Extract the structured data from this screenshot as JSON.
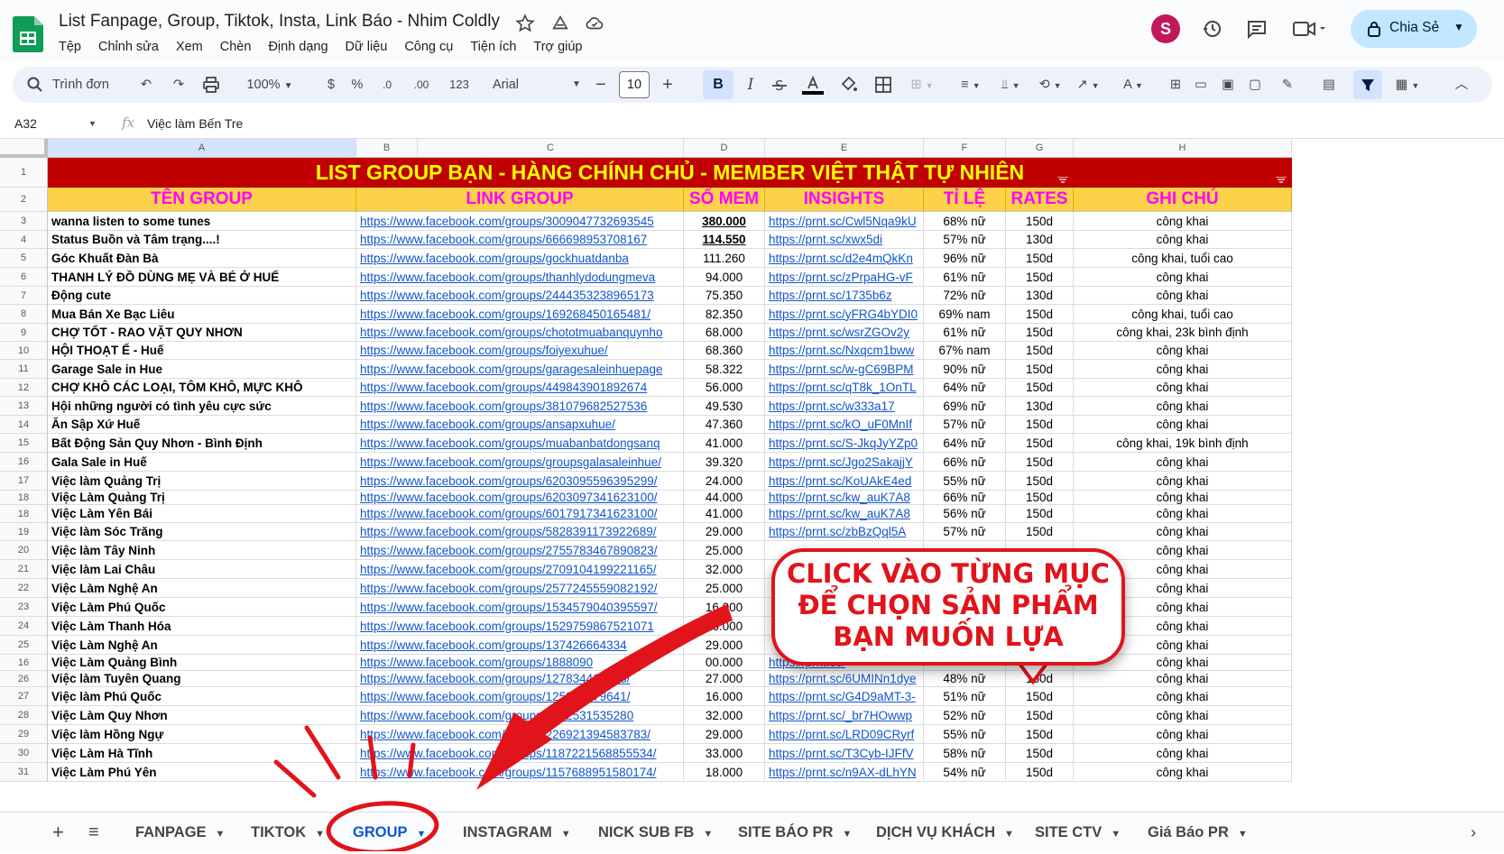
{
  "app": {
    "title": "List Fanpage, Group, Tiktok, Insta, Link Báo - Nhim Coldly",
    "menu": [
      "Tệp",
      "Chỉnh sửa",
      "Xem",
      "Chèn",
      "Định dạng",
      "Dữ liệu",
      "Công cụ",
      "Tiện ích",
      "Trợ giúp"
    ],
    "share_label": "Chia Sẻ",
    "avatar_letter": "S",
    "accent": "#c2e7ff"
  },
  "toolbar": {
    "search_label": "Trình đơn",
    "zoom": "100%",
    "currency": "$",
    "percent": "%",
    "dec_less": ".0",
    "dec_more": ".00",
    "number_fmt": "123",
    "font": "Arial",
    "font_size": "10",
    "bold": "B",
    "italic": "I"
  },
  "formula": {
    "cell_ref": "A32",
    "fx": "fx",
    "value": "Việc làm Bến Tre"
  },
  "columns": [
    "A",
    "B",
    "C",
    "D",
    "E",
    "F",
    "G",
    "H"
  ],
  "banner": "LIST GROUP BẠN - HÀNG CHÍNH CHỦ - MEMBER VIỆT THẬT TỰ NHIÊN",
  "headers": [
    "TÊN GROUP",
    "LINK GROUP",
    "SỐ MEM",
    "INSIGHTS",
    "TỈ LỆ",
    "RATES",
    "GHI CHÚ"
  ],
  "rows": [
    {
      "n": "3",
      "name": "wanna listen to some tunes",
      "link": "https://www.facebook.com/groups/3009047732693545",
      "mem": "380.000",
      "ins": "https://prnt.sc/Cwl5Nqa9kU",
      "ratio": "68% nữ",
      "rate": "150d",
      "note": "công khai"
    },
    {
      "n": "4",
      "name": "Status Buồn và Tâm trạng....!",
      "link": "https://www.facebook.com/groups/666698953708167",
      "mem": "114.550",
      "ins": "https://prnt.sc/xwx5di",
      "ratio": "57% nữ",
      "rate": "130d",
      "note": "công khai"
    },
    {
      "n": "5",
      "name": "Góc Khuất Đàn Bà",
      "link": "https://www.facebook.com/groups/gockhuatdanba",
      "mem": "111.260",
      "ins": "https://prnt.sc/d2e4mQkKn",
      "ratio": "96% nữ",
      "rate": "150d",
      "note": "công khai, tuổi cao"
    },
    {
      "n": "6",
      "name": "THANH LÝ ĐỒ DÙNG MẸ VÀ BÉ Ở HUẾ",
      "link": "https://www.facebook.com/groups/thanhlydodungmeva",
      "mem": "94.000",
      "ins": "https://prnt.sc/zPrpaHG-vF",
      "ratio": "61% nữ",
      "rate": "150d",
      "note": "công khai"
    },
    {
      "n": "7",
      "name": "Động cute",
      "link": "https://www.facebook.com/groups/2444353238965173",
      "mem": "75.350",
      "ins": "https://prnt.sc/1735b6z",
      "ratio": "72% nữ",
      "rate": "130d",
      "note": "công khai"
    },
    {
      "n": "8",
      "name": "Mua Bán Xe Bạc Liêu",
      "link": "https://www.facebook.com/groups/169268450165481/",
      "mem": "82.350",
      "ins": "https://prnt.sc/yFRG4bYDI0",
      "ratio": "69% nam",
      "rate": "150d",
      "note": "công khai, tuổi cao"
    },
    {
      "n": "9",
      "name": "CHỢ TỐT - RAO VẶT QUY NHƠN",
      "link": "https://www.facebook.com/groups/chototmuabanquynho",
      "mem": "68.000",
      "ins": "https://prnt.sc/wsrZGOv2y",
      "ratio": "61% nữ",
      "rate": "150d",
      "note": "công khai, 23k bình định"
    },
    {
      "n": "10",
      "name": "HỘI THOẠT Ế - Huế",
      "link": "https://www.facebook.com/groups/foiyexuhue/",
      "mem": "68.360",
      "ins": "https://prnt.sc/Nxqcm1bww",
      "ratio": "67% nam",
      "rate": "150d",
      "note": "công khai"
    },
    {
      "n": "11",
      "name": "Garage Sale in Hue",
      "link": "https://www.facebook.com/groups/garagesaleinhuepage",
      "mem": "58.322",
      "ins": "https://prnt.sc/w-gC69BPM",
      "ratio": "90% nữ",
      "rate": "150d",
      "note": "công khai"
    },
    {
      "n": "12",
      "name": "CHỢ KHÔ CÁC LOẠI, TÔM KHÔ, MỰC KHÔ",
      "link": "https://www.facebook.com/groups/449843901892674",
      "mem": "56.000",
      "ins": "https://prnt.sc/qT8k_1OnTL",
      "ratio": "64% nữ",
      "rate": "150d",
      "note": "công khai"
    },
    {
      "n": "13",
      "name": "Hội những người có tình yêu cực sức",
      "link": "https://www.facebook.com/groups/381079682527536",
      "mem": "49.530",
      "ins": "https://prnt.sc/w333a17",
      "ratio": "69% nữ",
      "rate": "130d",
      "note": "công khai"
    },
    {
      "n": "14",
      "name": "Ăn Sập Xứ Huế",
      "link": "https://www.facebook.com/groups/ansapxuhue/",
      "mem": "47.360",
      "ins": "https://prnt.sc/kO_uF0MnIf",
      "ratio": "57% nữ",
      "rate": "150d",
      "note": "công khai"
    },
    {
      "n": "15",
      "name": "Bất Động Sản Quy Nhơn - Bình Định",
      "link": "https://www.facebook.com/groups/muabanbatdongsanq",
      "mem": "41.000",
      "ins": "https://prnt.sc/S-JkqJyYZp0",
      "ratio": "64% nữ",
      "rate": "150d",
      "note": "công khai, 19k bình định"
    },
    {
      "n": "16",
      "name": "Gala Sale in Huế",
      "link": "https://www.facebook.com/groups/groupsgalasaleinhue/",
      "mem": "39.320",
      "ins": "https://prnt.sc/Jgo2SakajjY",
      "ratio": "66% nữ",
      "rate": "150d",
      "note": "công khai"
    },
    {
      "n": "17",
      "name": "Việc làm Quảng Trị",
      "link": "https://www.facebook.com/groups/6203095596395299/",
      "mem": "24.000",
      "ins": "https://prnt.sc/KoUAkE4ed",
      "ratio": "55% nữ",
      "rate": "150d",
      "note": "công khai"
    },
    {
      "n": "18",
      "name": "Việc Làm Quảng Trị",
      "link": "https://www.facebook.com/groups/6203097341623100/",
      "mem": "44.000",
      "ins": "https://prnt.sc/kw_auK7A8",
      "ratio": "66% nữ",
      "rate": "150d",
      "note": "công khai"
    },
    {
      "n": "18",
      "name": "Việc Làm Yên Bái",
      "link": "https://www.facebook.com/groups/6017917341623100/",
      "mem": "41.000",
      "ins": "https://prnt.sc/kw_auK7A8",
      "ratio": "56% nữ",
      "rate": "150d",
      "note": "công khai"
    },
    {
      "n": "19",
      "name": "Việc làm Sóc Trăng",
      "link": "https://www.facebook.com/groups/5828391173922689/",
      "mem": "29.000",
      "ins": "https://prnt.sc/zbBzQql5A",
      "ratio": "57% nữ",
      "rate": "150d",
      "note": "công khai"
    },
    {
      "n": "20",
      "name": "Việc làm Tây Ninh",
      "link": "https://www.facebook.com/groups/2755783467890823/",
      "mem": "25.000",
      "ins": "",
      "ratio": "",
      "rate": "",
      "note": "công khai"
    },
    {
      "n": "21",
      "name": "Việc làm Lai Châu",
      "link": "https://www.facebook.com/groups/2709104199221165/",
      "mem": "32.000",
      "ins": "",
      "ratio": "",
      "rate": "",
      "note": "công khai"
    },
    {
      "n": "22",
      "name": "Việc Làm Nghệ An",
      "link": "https://www.facebook.com/groups/2577245559082192/",
      "mem": "25.000",
      "ins": "",
      "ratio": "",
      "rate": "",
      "note": "công khai"
    },
    {
      "n": "23",
      "name": "Việc Làm Phú Quốc",
      "link": "https://www.facebook.com/groups/1534579040395597/",
      "mem": "16.000",
      "ins": "",
      "ratio": "",
      "rate": "",
      "note": "công khai"
    },
    {
      "n": "24",
      "name": "Việc Làm Thanh Hóa",
      "link": "https://www.facebook.com/groups/1529759867521071",
      "mem": "26.000",
      "ins": "",
      "ratio": "",
      "rate": "",
      "note": "công khai"
    },
    {
      "n": "25",
      "name": "Việc Làm Nghệ An",
      "link": "https://www.facebook.com/groups/137426664334",
      "mem": "29.000",
      "ins": "",
      "ratio": "",
      "rate": "",
      "note": "công khai"
    },
    {
      "n": "16",
      "name": "Việc Làm Quảng Bình",
      "link": "https://www.facebook.com/groups/1888090",
      "mem": "00.000",
      "ins": "https://prnt.sc/",
      "ratio": "",
      "rate": "",
      "note": "công khai"
    },
    {
      "n": "26",
      "name": "Việc làm Tuyên Quang",
      "link": "https://www.facebook.com/groups/127834415738/",
      "mem": "27.000",
      "ins": "https://prnt.sc/6UMINn1dye",
      "ratio": "48% nữ",
      "rate": "150d",
      "note": "công khai"
    },
    {
      "n": "27",
      "name": "Việc làm Phú Quốc",
      "link": "https://www.facebook.com/groups/125973479641/",
      "mem": "16.000",
      "ins": "https://prnt.sc/G4D9aMT-3-",
      "ratio": "51% nữ",
      "rate": "150d",
      "note": "công khai"
    },
    {
      "n": "28",
      "name": "Việc Làm Quy Nhơn",
      "link": "https://www.facebook.com/groups/0742531535280",
      "mem": "32.000",
      "ins": "https://prnt.sc/_br7HOwwp",
      "ratio": "52% nữ",
      "rate": "150d",
      "note": "công khai"
    },
    {
      "n": "29",
      "name": "Việc làm Hồng Ngự",
      "link": "https://www.facebook.com/groups/226921394583783/",
      "mem": "29.000",
      "ins": "https://prnt.sc/LRD09CRyrf",
      "ratio": "55% nữ",
      "rate": "150d",
      "note": "công khai"
    },
    {
      "n": "30",
      "name": "Việc Làm Hà Tĩnh",
      "link": "https://www.facebook.com/groups/1187221568855534/",
      "mem": "33.000",
      "ins": "https://prnt.sc/T3Cyb-IJFfV",
      "ratio": "58% nữ",
      "rate": "150d",
      "note": "công khai"
    },
    {
      "n": "31",
      "name": "Việc Làm Phú Yên",
      "link": "https://www.facebook.com/groups/1157688951580174/",
      "mem": "18.000",
      "ins": "https://prnt.sc/n9AX-dLhYN",
      "ratio": "54% nữ",
      "rate": "150d",
      "note": "công khai"
    }
  ],
  "callout": [
    "CLICK VÀO TỪNG MỤC",
    "ĐỂ CHỌN SẢN PHẨM",
    "BẠN MUỐN LỰA"
  ],
  "tabs": [
    "FANPAGE",
    "TIKTOK",
    "GROUP",
    "INSTAGRAM",
    "NICK SUB FB",
    "SITE BÁO PR",
    "DỊCH VỤ KHÁCH",
    "SITE CTV",
    "Giá Báo PR"
  ],
  "colors": {
    "banner_bg": "#c00000",
    "banner_text": "#ffff00",
    "header_bg": "#fbd249",
    "header_text": "#ff00ff",
    "annotation_red": "#e0141a"
  }
}
